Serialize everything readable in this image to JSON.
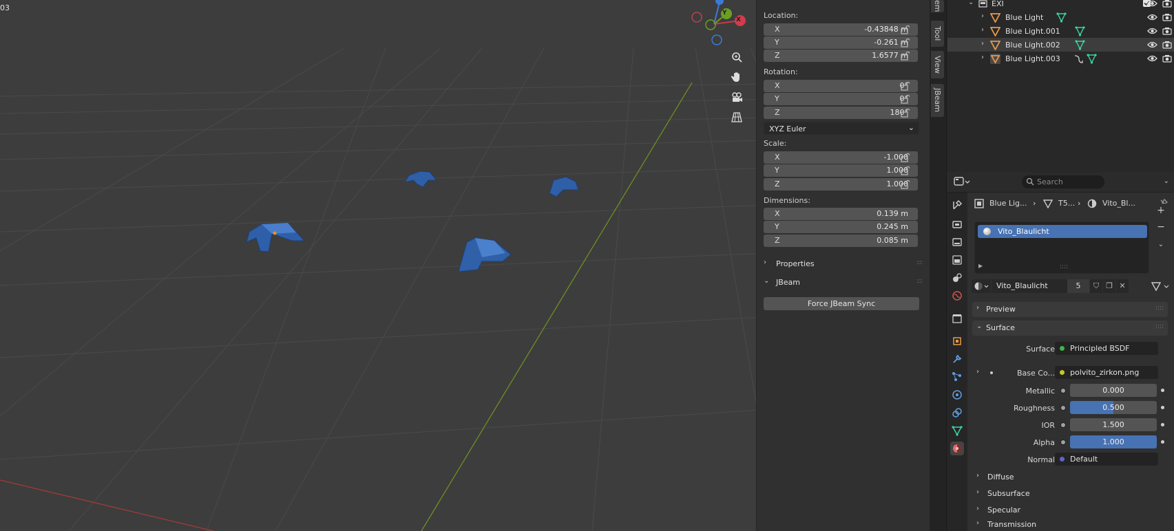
{
  "viewport": {
    "corner_text": "03",
    "gizmo": {
      "x": "X",
      "y": "Y"
    },
    "nav": [
      "zoom-icon",
      "hand-pan-icon",
      "camera-icon",
      "grid-view-icon"
    ]
  },
  "transform": {
    "location_label": "Location:",
    "location": [
      {
        "axis": "X",
        "value": "-0.43848 m"
      },
      {
        "axis": "Y",
        "value": "-0.261 m"
      },
      {
        "axis": "Z",
        "value": "1.6577 m"
      }
    ],
    "rotation_label": "Rotation:",
    "rotation": [
      {
        "axis": "X",
        "value": "0°"
      },
      {
        "axis": "Y",
        "value": "0°"
      },
      {
        "axis": "Z",
        "value": "180°"
      }
    ],
    "rotation_mode": "XYZ Euler",
    "scale_label": "Scale:",
    "scale": [
      {
        "axis": "X",
        "value": "-1.000"
      },
      {
        "axis": "Y",
        "value": "1.000"
      },
      {
        "axis": "Z",
        "value": "1.000"
      }
    ],
    "dimensions_label": "Dimensions:",
    "dimensions": [
      {
        "axis": "X",
        "value": "0.139 m"
      },
      {
        "axis": "Y",
        "value": "0.245 m"
      },
      {
        "axis": "Z",
        "value": "0.085 m"
      }
    ],
    "properties_section": "Properties",
    "jbeam_section": "JBeam",
    "jbeam_button": "Force JBeam Sync"
  },
  "vtabs": [
    "em",
    "Tool",
    "View",
    "JBeam"
  ],
  "outliner": {
    "collection": "EXI",
    "rows": [
      {
        "label": "Blue Light",
        "selected": false
      },
      {
        "label": "Blue Light.001",
        "selected": false
      },
      {
        "label": "Blue Light.002",
        "selected": true
      },
      {
        "label": "Blue Light.003",
        "selected": false
      }
    ]
  },
  "properties": {
    "search_placeholder": "Search",
    "breadcrumb": {
      "object": "Blue Lig...",
      "mesh": "T5...",
      "material": "Vito_Bl..."
    },
    "slot_name": "Vito_Blaulicht",
    "material_name": "Vito_Blaulicht",
    "users": "5",
    "preview": "Preview",
    "surface_panel": "Surface",
    "surface": {
      "label": "Surface",
      "value": "Principled BSDF",
      "color": "#3fb54a"
    },
    "base_color": {
      "label": "Base Co...",
      "value": "polvito_zirkon.png",
      "color": "#c7c729"
    },
    "metallic": {
      "label": "Metallic",
      "value": "0.000",
      "fraction": 0.0
    },
    "roughness": {
      "label": "Roughness",
      "value": "0.500",
      "fraction": 0.5
    },
    "ior": {
      "label": "IOR",
      "value": "1.500",
      "fraction": 0.0
    },
    "alpha": {
      "label": "Alpha",
      "value": "1.000",
      "fraction": 1.0
    },
    "normal": {
      "label": "Normal",
      "value": "Default",
      "color": "#6363c7"
    },
    "subpanels": [
      "Diffuse",
      "Subsurface",
      "Specular",
      "Transmission"
    ]
  }
}
